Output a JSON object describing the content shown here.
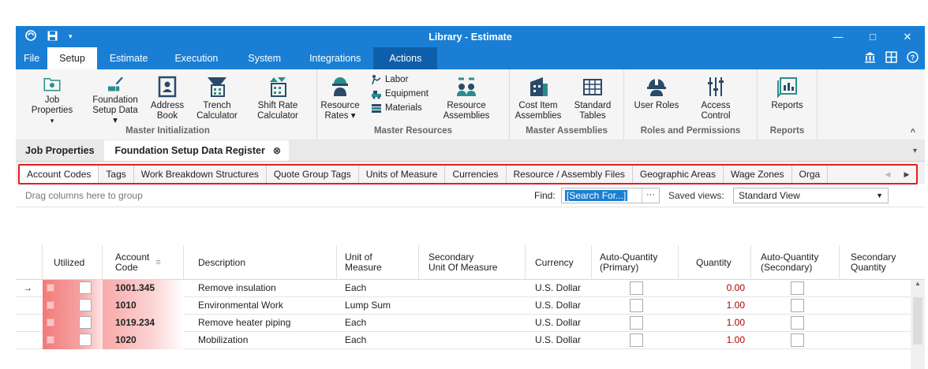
{
  "window": {
    "title": "Library - Estimate",
    "minimize": "—",
    "maximize": "□",
    "close": "✕"
  },
  "tabs": [
    "File",
    "Setup",
    "Estimate",
    "Execution",
    "System",
    "Integrations",
    "Actions"
  ],
  "ribbon": {
    "master_init": [
      {
        "label1": "Job Properties",
        "label2": "▾"
      },
      {
        "label1": "Foundation",
        "label2": "Setup Data ▾"
      },
      {
        "label1": "Address",
        "label2": "Book"
      },
      {
        "label1": "Trench",
        "label2": "Calculator"
      },
      {
        "label1": "Shift Rate",
        "label2": "Calculator"
      }
    ],
    "master_resources": {
      "rates": {
        "label1": "Resource",
        "label2": "Rates ▾"
      },
      "small": [
        "Labor",
        "Equipment",
        "Materials"
      ],
      "assemblies": {
        "label1": "Resource",
        "label2": "Assemblies"
      }
    },
    "master_assemblies": [
      {
        "label1": "Cost Item",
        "label2": "Assemblies"
      },
      {
        "label1": "Standard",
        "label2": "Tables"
      }
    ],
    "roles": [
      {
        "label1": "User Roles",
        "label2": ""
      },
      {
        "label1": "Access",
        "label2": "Control"
      }
    ],
    "reports": {
      "label1": "Reports",
      "label2": ""
    },
    "group_labels": [
      "Master Initialization",
      "Master Resources",
      "Master Assemblies",
      "Roles and Permissions",
      "Reports"
    ],
    "collapse": "^"
  },
  "doc_tabs": [
    "Job Properties",
    "Foundation Setup Data Register"
  ],
  "doc_tab_close": "⊗",
  "doc_tab_arrow": "▾",
  "sub_tabs": [
    "Account Codes",
    "Tags",
    "Work Breakdown Structures",
    "Quote Group Tags",
    "Units of Measure",
    "Currencies",
    "Resource / Assembly Files",
    "Geographic Areas",
    "Wage Zones",
    "Orga"
  ],
  "sub_nav": {
    "left": "◀",
    "right": "▶"
  },
  "toolbar": {
    "group_hint": "Drag columns here to group",
    "find_label": "Find:",
    "find_placeholder": "[Search For...]",
    "find_button": "···",
    "saved_views_label": "Saved views:",
    "saved_view_value": "Standard View"
  },
  "columns": [
    {
      "l1": "Utilized",
      "l2": ""
    },
    {
      "l1": "Account",
      "l2": "Code"
    },
    {
      "l1": "Description",
      "l2": ""
    },
    {
      "l1": "Unit of",
      "l2": "Measure"
    },
    {
      "l1": "Secondary",
      "l2": "Unit Of Measure"
    },
    {
      "l1": "Currency",
      "l2": ""
    },
    {
      "l1": "Auto-Quantity",
      "l2": "(Primary)"
    },
    {
      "l1": "Quantity",
      "l2": ""
    },
    {
      "l1": "Auto-Quantity",
      "l2": "(Secondary)"
    },
    {
      "l1": "Secondary",
      "l2": "Quantity"
    }
  ],
  "rows": [
    {
      "indicator": "→",
      "code": "1001.345",
      "description": "Remove insulation",
      "unit": "Each",
      "secondary_unit": "",
      "currency": "U.S. Dollar",
      "quantity": "0.00"
    },
    {
      "indicator": "",
      "code": "1010",
      "description": "Environmental Work",
      "unit": "Lump Sum",
      "secondary_unit": "",
      "currency": "U.S. Dollar",
      "quantity": "1.00"
    },
    {
      "indicator": "",
      "code": "1019.234",
      "description": "Remove heater piping",
      "unit": "Each",
      "secondary_unit": "",
      "currency": "U.S. Dollar",
      "quantity": "1.00"
    },
    {
      "indicator": "",
      "code": "1020",
      "description": "Mobilization",
      "unit": "Each",
      "secondary_unit": "",
      "currency": "U.S. Dollar",
      "quantity": "1.00"
    }
  ],
  "colors": {
    "accent": "#1a7fd4",
    "highlight": "#e02020",
    "qty": "#b00000"
  }
}
